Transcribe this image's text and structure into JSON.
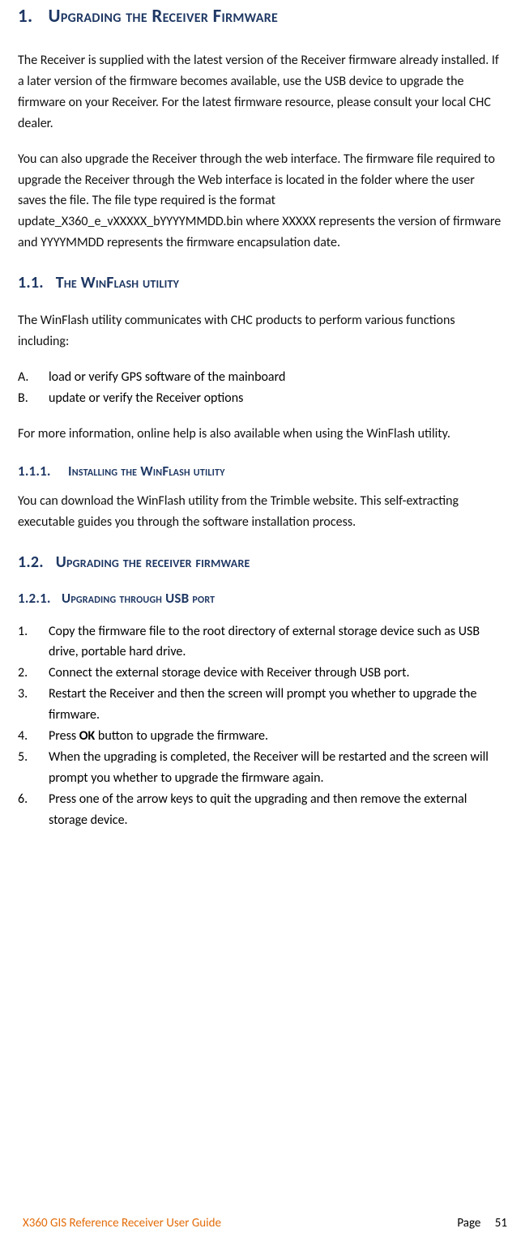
{
  "h1_num": "1.",
  "h1_text": "Upgrading the Receiver Firmware",
  "para1": "The Receiver is supplied with the latest version of the Receiver firmware already installed. If a later version of the firmware becomes available, use the USB device to upgrade the firmware on your Receiver. For the latest firmware resource, please consult your local CHC dealer.",
  "para2": "You can also upgrade the Receiver through the web interface. The firmware file required to upgrade the Receiver through the Web interface is located in the folder where the user saves the file. The file type required is the format update_X360_e_vXXXXX_bYYYYMMDD.bin where XXXXX represents the version of firmware and YYYYMMDD represents the firmware encapsulation date.",
  "h11_num": "1.1.",
  "h11_text": "The WinFlash utility",
  "para3": "The WinFlash utility communicates with CHC products to perform various functions including:",
  "listAB": [
    {
      "marker": "A.",
      "text": "load or verify GPS software of the mainboard"
    },
    {
      "marker": "B.",
      "text": "update or verify the Receiver options"
    }
  ],
  "para4": "For more information, online help is also available when using the WinFlash utility.",
  "h111_num": "1.1.1.",
  "h111_text": "Installing the WinFlash utility",
  "para5": "You can download the WinFlash utility from the Trimble website. This self-extracting executable guides you through the software installation process.",
  "h12_num": "1.2.",
  "h12_text": "Upgrading the receiver firmware",
  "h121_num": "1.2.1.",
  "h121_text": "Upgrading through USB port",
  "steps": [
    {
      "marker": "1.",
      "text": "Copy the firmware file to the root directory of external storage device such as USB drive, portable hard drive."
    },
    {
      "marker": "2.",
      "text": "Connect the external storage device with Receiver through USB port."
    },
    {
      "marker": "3.",
      "text": "Restart the Receiver and then the screen will prompt you whether to upgrade the firmware."
    },
    {
      "marker": "4.",
      "pre": "Press ",
      "bold": "OK",
      "post": " button to upgrade the firmware."
    },
    {
      "marker": "5.",
      "text": "When the upgrading is completed, the Receiver will be restarted and the screen will prompt you whether to upgrade the firmware again."
    },
    {
      "marker": "6.",
      "text": "Press one of the arrow keys to quit the upgrading and then remove the external storage device."
    }
  ],
  "footer_left": "X360 GIS Reference Receiver User Guide",
  "footer_page_label": "Page",
  "footer_page_num": "51"
}
